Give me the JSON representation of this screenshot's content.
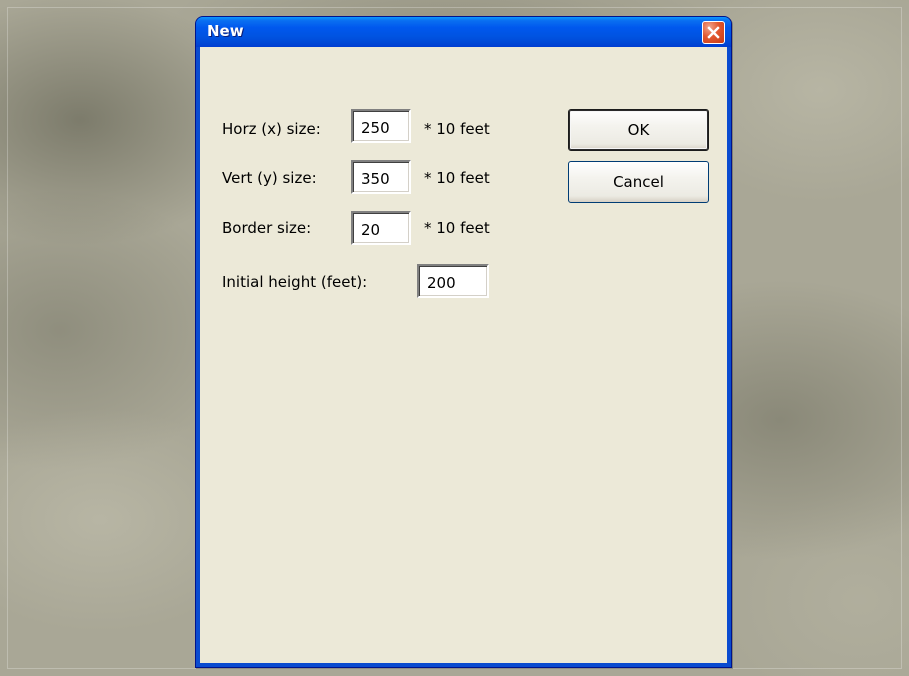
{
  "window": {
    "title": "New"
  },
  "fields": {
    "horz": {
      "label": "Horz (x) size:",
      "value": "250",
      "unit": "* 10 feet"
    },
    "vert": {
      "label": "Vert (y) size:",
      "value": "350",
      "unit": "* 10 feet"
    },
    "border": {
      "label": "Border size:",
      "value": "20",
      "unit": "* 10 feet"
    },
    "initial_height": {
      "label": "Initial height (feet):",
      "value": "200"
    }
  },
  "buttons": {
    "ok": "OK",
    "cancel": "Cancel"
  },
  "icons": {
    "close": "close-icon"
  },
  "colors": {
    "titlebar": "#0058ee",
    "client_bg": "#ece9d8",
    "close_button": "#e2572f",
    "desktop": "#a9a796"
  }
}
